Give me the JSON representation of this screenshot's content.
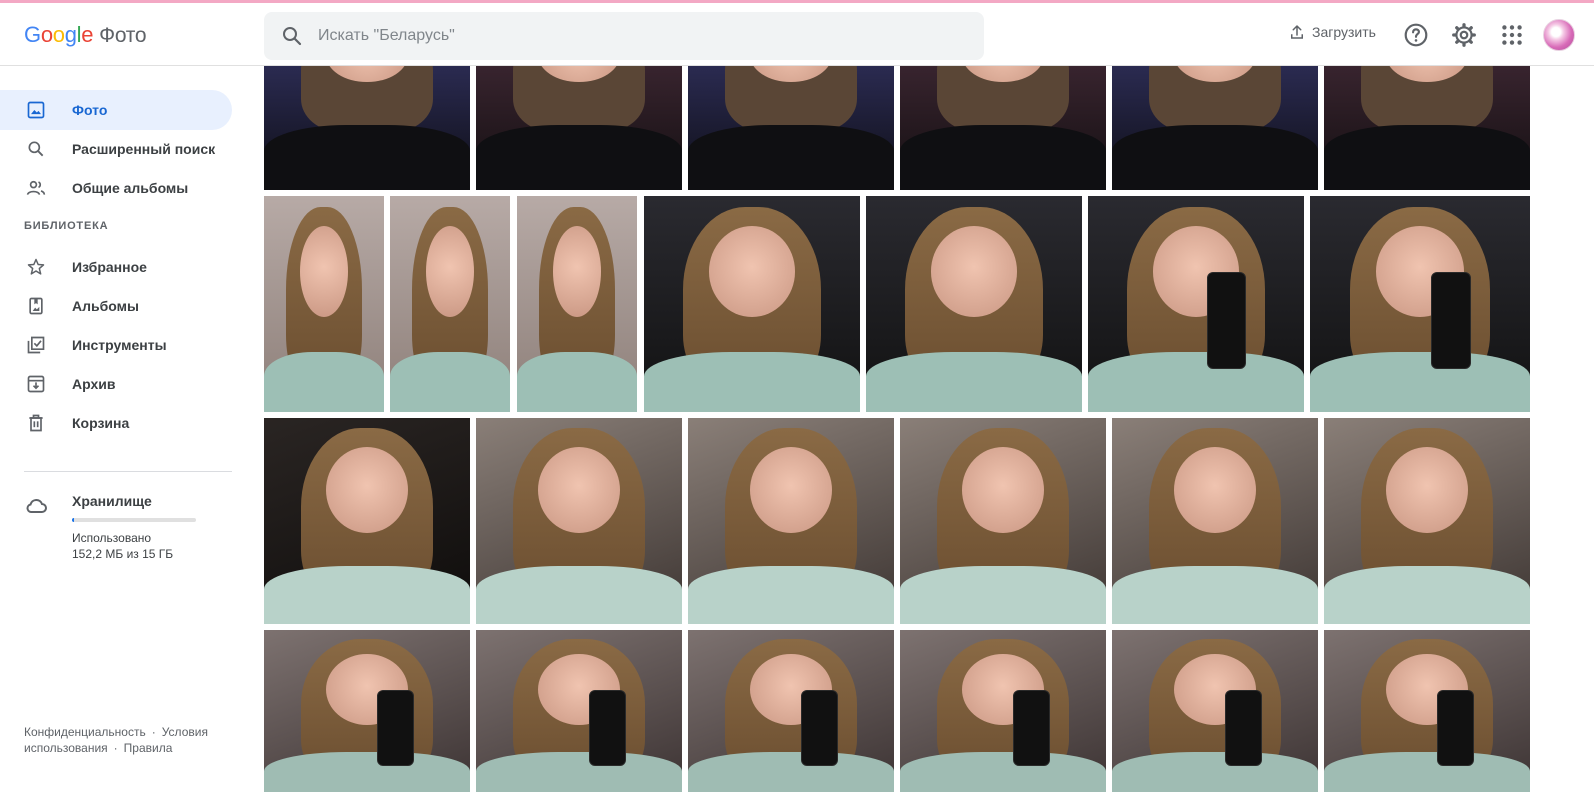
{
  "app": {
    "logo_letters": [
      "G",
      "o",
      "o",
      "g",
      "l",
      "e"
    ],
    "product": "Фото"
  },
  "search": {
    "placeholder": "Искать \"Беларусь\"",
    "icon": "search-icon"
  },
  "header": {
    "upload_label": "Загрузить",
    "icons": [
      "upload-icon",
      "help-icon",
      "settings-icon",
      "apps-grid-icon"
    ]
  },
  "sidebar": {
    "items": [
      {
        "label": "Фото",
        "icon": "photo-icon",
        "active": true
      },
      {
        "label": "Расширенный поиск",
        "icon": "search-icon",
        "active": false
      },
      {
        "label": "Общие альбомы",
        "icon": "shared-people-icon",
        "active": false
      }
    ],
    "library_title": "БИБЛИОТЕКА",
    "library_items": [
      {
        "label": "Избранное",
        "icon": "star-icon"
      },
      {
        "label": "Альбомы",
        "icon": "album-icon"
      },
      {
        "label": "Инструменты",
        "icon": "utilities-icon"
      },
      {
        "label": "Архив",
        "icon": "archive-icon"
      },
      {
        "label": "Корзина",
        "icon": "trash-icon"
      }
    ],
    "storage": {
      "title": "Хранилище",
      "used_label": "Использовано",
      "amount": "152,2 МБ из 15 ГБ",
      "used_fraction": 0.01
    },
    "footer": {
      "privacy": "Конфиденциальность",
      "terms": "Условия использования",
      "policy": "Правила",
      "separator": "·"
    }
  },
  "colors": {
    "accent": "#1a73e8",
    "active_bg": "#e8f0fe",
    "active_text": "#1967d2"
  }
}
